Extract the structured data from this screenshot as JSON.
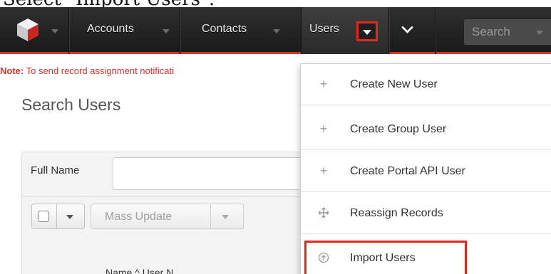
{
  "caption": "Select \"Import Users\".",
  "navbar": {
    "items": [
      {
        "label": "Accounts"
      },
      {
        "label": "Contacts"
      },
      {
        "label": "Users"
      }
    ],
    "search_placeholder": "Search",
    "accent_color": "#d7342a"
  },
  "note": {
    "prefix": "Note:",
    "text": " To send record assignment notificati"
  },
  "page": {
    "title": "Search Users",
    "filter_label": "Full Name",
    "mass_update_label": "Mass Update",
    "column_headers": "Name  ^    User N"
  },
  "dropdown": {
    "items": [
      {
        "label": "Create New User",
        "icon": "plus-icon"
      },
      {
        "label": "Create Group User",
        "icon": "plus-icon"
      },
      {
        "label": "Create Portal API User",
        "icon": "plus-icon"
      },
      {
        "label": "Reassign Records",
        "icon": "move-arrows-icon"
      },
      {
        "label": "Import Users",
        "icon": "import-circle-icon"
      }
    ]
  },
  "highlight_color": "#e0281c"
}
